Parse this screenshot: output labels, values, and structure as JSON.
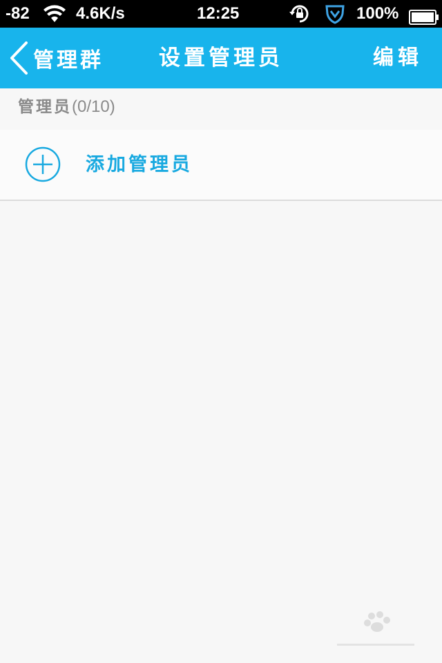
{
  "status_bar": {
    "signal": "-82",
    "speed": "4.6K/s",
    "time": "12:25",
    "battery": "100%",
    "wifi_icon": "wifi-icon",
    "lock_icon": "rotation-lock-icon",
    "shield_icon": "shield-icon",
    "battery_icon": "battery-icon"
  },
  "nav": {
    "back_label": "管理群",
    "title": "设置管理员",
    "edit_label": "编辑",
    "back_icon": "chevron-left-icon"
  },
  "section": {
    "label": "管理员",
    "count": "(0/10)"
  },
  "add_row": {
    "label": "添加管理员",
    "icon": "plus-circle-icon"
  },
  "colors": {
    "accent": "#18b4ec",
    "accent_text": "#18a9e0",
    "background": "#f7f7f7",
    "status_bar": "#000000"
  }
}
